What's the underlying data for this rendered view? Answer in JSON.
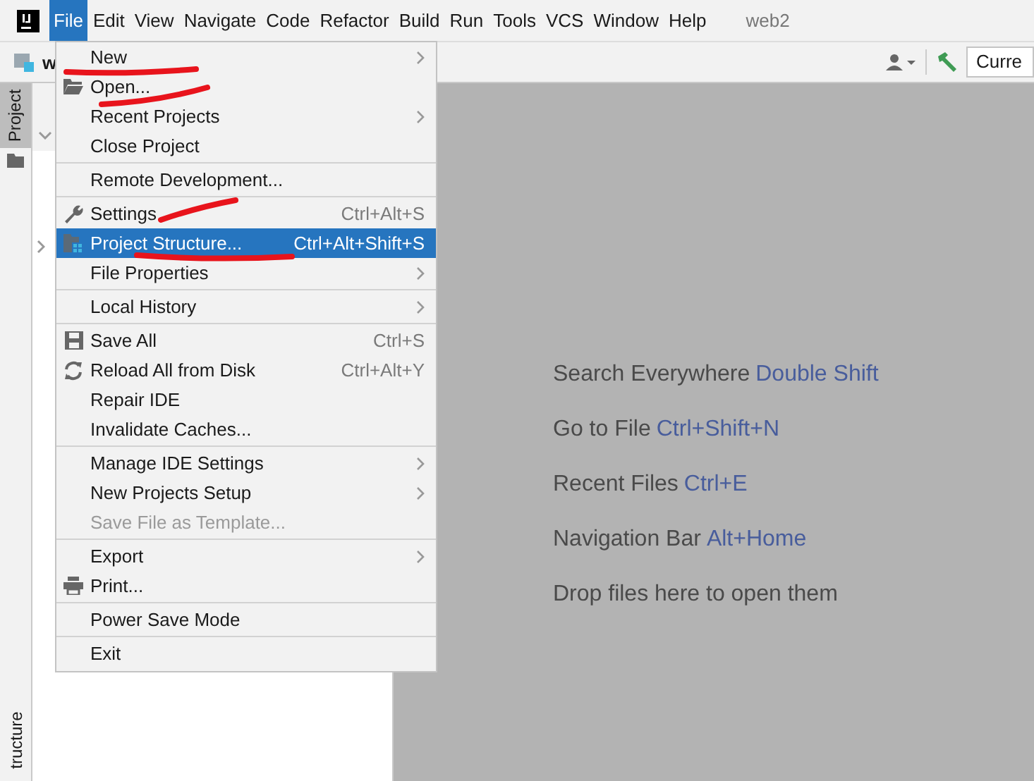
{
  "menu_bar": {
    "items": [
      {
        "label": "File",
        "selected": true
      },
      {
        "label": "Edit",
        "selected": false
      },
      {
        "label": "View",
        "selected": false
      },
      {
        "label": "Navigate",
        "selected": false
      },
      {
        "label": "Code",
        "selected": false
      },
      {
        "label": "Refactor",
        "selected": false
      },
      {
        "label": "Build",
        "selected": false
      },
      {
        "label": "Run",
        "selected": false
      },
      {
        "label": "Tools",
        "selected": false
      },
      {
        "label": "VCS",
        "selected": false
      },
      {
        "label": "Window",
        "selected": false
      },
      {
        "label": "Help",
        "selected": false
      }
    ],
    "project_name": "web2"
  },
  "toolbar": {
    "breadcrumb": "w",
    "config_field": "Curre"
  },
  "tool_strip": {
    "top_tab": "Project",
    "bottom_tab": "tructure"
  },
  "file_menu": {
    "groups": [
      [
        {
          "label": "New",
          "submenu": true,
          "selected": false,
          "disabled": false
        },
        {
          "label": "Open...",
          "submenu": false,
          "selected": false,
          "disabled": false
        },
        {
          "label": "Recent Projects",
          "submenu": true,
          "selected": false,
          "disabled": false
        },
        {
          "label": "Close Project",
          "submenu": false,
          "selected": false,
          "disabled": false
        }
      ],
      [
        {
          "label": "Remote Development...",
          "submenu": false,
          "selected": false,
          "disabled": false
        }
      ],
      [
        {
          "label": "Settings",
          "shortcut": "Ctrl+Alt+S",
          "submenu": false,
          "selected": false,
          "disabled": false
        },
        {
          "label": "Project Structure...",
          "shortcut": "Ctrl+Alt+Shift+S",
          "submenu": false,
          "selected": true,
          "disabled": false
        },
        {
          "label": "File Properties",
          "submenu": true,
          "selected": false,
          "disabled": false
        }
      ],
      [
        {
          "label": "Local History",
          "submenu": true,
          "selected": false,
          "disabled": false
        }
      ],
      [
        {
          "label": "Save All",
          "shortcut": "Ctrl+S",
          "submenu": false,
          "selected": false,
          "disabled": false
        },
        {
          "label": "Reload All from Disk",
          "shortcut": "Ctrl+Alt+Y",
          "submenu": false,
          "selected": false,
          "disabled": false
        },
        {
          "label": "Repair IDE",
          "submenu": false,
          "selected": false,
          "disabled": false
        },
        {
          "label": "Invalidate Caches...",
          "submenu": false,
          "selected": false,
          "disabled": false
        }
      ],
      [
        {
          "label": "Manage IDE Settings",
          "submenu": true,
          "selected": false,
          "disabled": false
        },
        {
          "label": "New Projects Setup",
          "submenu": true,
          "selected": false,
          "disabled": false
        },
        {
          "label": "Save File as Template...",
          "submenu": false,
          "selected": false,
          "disabled": true
        }
      ],
      [
        {
          "label": "Export",
          "submenu": true,
          "selected": false,
          "disabled": false
        },
        {
          "label": "Print...",
          "submenu": false,
          "selected": false,
          "disabled": false
        }
      ],
      [
        {
          "label": "Power Save Mode",
          "submenu": false,
          "selected": false,
          "disabled": false
        }
      ],
      [
        {
          "label": "Exit",
          "submenu": false,
          "selected": false,
          "disabled": false
        }
      ]
    ]
  },
  "editor_hints": [
    {
      "text": "Search Everywhere",
      "shortcut": "Double Shift"
    },
    {
      "text": "Go to File",
      "shortcut": "Ctrl+Shift+N"
    },
    {
      "text": "Recent Files",
      "shortcut": "Ctrl+E"
    },
    {
      "text": "Navigation Bar",
      "shortcut": "Alt+Home"
    },
    {
      "text": "Drop files here to open them"
    }
  ]
}
